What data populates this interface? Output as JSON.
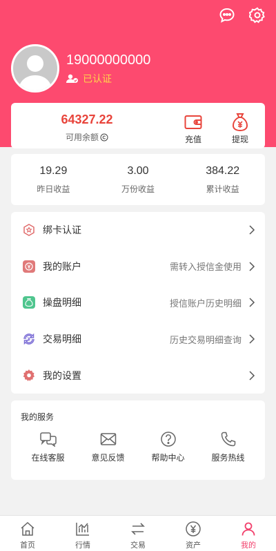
{
  "colors": {
    "brand": "#fd4a6f",
    "balance": "#e8443b",
    "verified": "#ffd54a",
    "active_tab": "#f2406c"
  },
  "header": {
    "icons": [
      "chat-icon",
      "gear-icon"
    ],
    "phone": "19000000000",
    "verified_label": "已认证"
  },
  "balance": {
    "amount": "64327.22",
    "label": "可用余额",
    "recharge_label": "充值",
    "withdraw_label": "提现"
  },
  "earnings": [
    {
      "value": "19.29",
      "label": "昨日收益"
    },
    {
      "value": "3.00",
      "label": "万份收益"
    },
    {
      "value": "384.22",
      "label": "累计收益"
    }
  ],
  "menu": [
    {
      "label": "绑卡认证",
      "sub": "",
      "icon": "badge-icon"
    },
    {
      "label": "我的账户",
      "sub": "需转入授信金使用",
      "icon": "yen-square-icon"
    },
    {
      "label": "操盘明细",
      "sub": "授信账户历史明细",
      "icon": "money-bag-icon"
    },
    {
      "label": "交易明细",
      "sub": "历史交易明细查询",
      "icon": "exchange-icon"
    },
    {
      "label": "我的设置",
      "sub": "",
      "icon": "settings-icon"
    }
  ],
  "services": {
    "title": "我的服务",
    "items": [
      {
        "label": "在线客服",
        "icon": "chat-bubbles-icon"
      },
      {
        "label": "意见反馈",
        "icon": "envelope-icon"
      },
      {
        "label": "帮助中心",
        "icon": "help-icon"
      },
      {
        "label": "服务热线",
        "icon": "phone-icon"
      }
    ]
  },
  "tabs": [
    {
      "label": "首页",
      "icon": "home-icon"
    },
    {
      "label": "行情",
      "icon": "chart-icon"
    },
    {
      "label": "交易",
      "icon": "swap-icon"
    },
    {
      "label": "资产",
      "icon": "yen-circle-icon"
    },
    {
      "label": "我的",
      "icon": "user-icon",
      "active": true
    }
  ]
}
